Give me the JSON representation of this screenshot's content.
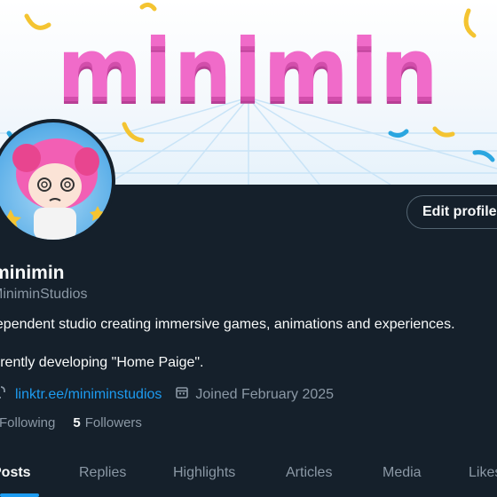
{
  "banner": {
    "title": "minimin"
  },
  "profile": {
    "edit_button": "Edit profile",
    "display_name": "minimin",
    "handle": "MiniminStudios",
    "bio_line1": "dependent studio creating immersive games, animations and experiences.",
    "bio_line2": "urrently developing \"Home Paige\".",
    "link": "linktr.ee/miniminstudios",
    "joined": "Joined February 2025",
    "following_label": "Following",
    "followers_count": "5",
    "followers_label": "Followers"
  },
  "tabs": [
    {
      "label": "Posts",
      "active": true
    },
    {
      "label": "Replies"
    },
    {
      "label": "Highlights"
    },
    {
      "label": "Articles"
    },
    {
      "label": "Media"
    },
    {
      "label": "Likes"
    }
  ],
  "colors": {
    "accent": "#1d9bf0",
    "background": "#15202b",
    "banner_pink": "#f06bc9"
  },
  "icons": [
    "link-icon",
    "calendar-icon"
  ]
}
